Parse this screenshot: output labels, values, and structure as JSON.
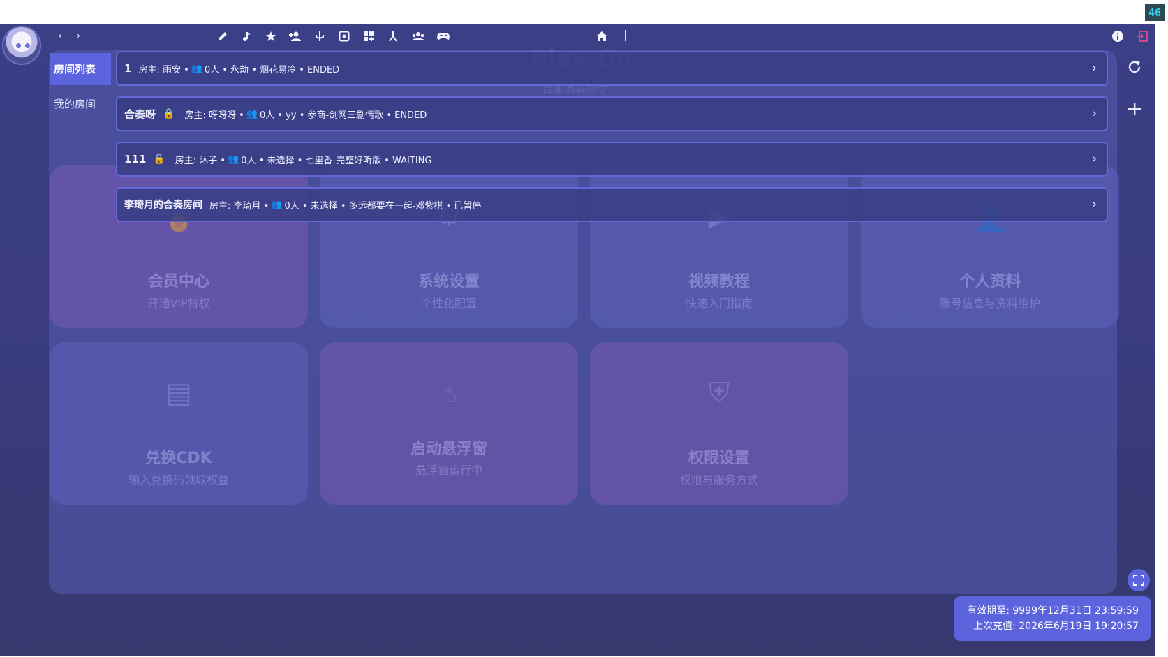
{
  "status": {
    "fps": "46"
  },
  "header": {
    "nav_back": "‹",
    "nav_forward": "›",
    "toolbar_icons": [
      "pencil-icon",
      "music-note-icon",
      "star-icon",
      "add-person-icon",
      "usb-icon",
      "gamepad-square-icon",
      "grid-plus-icon",
      "fork-icon",
      "group-icon",
      "controller-icon"
    ],
    "separator": "|",
    "home_icon": "home-icon",
    "info_icon": "info-icon",
    "exit_icon": "exit-icon"
  },
  "tabs": {
    "room_list": "房间列表",
    "my_rooms": "我的房间"
  },
  "rooms": [
    {
      "name": "1",
      "owner_label": "房主: 雨安 •",
      "count": "0人 • 永劫 • 烟花易冷 • ENDED",
      "locked": false
    },
    {
      "name": "合奏呀",
      "owner_label": "房主: 呀呀呀 •",
      "count": "0人 • yy • 参商-剑网三剧情歌 • ENDED",
      "locked": true
    },
    {
      "name": "111",
      "owner_label": "房主: 沐子 •",
      "count": "0人 • 未选择 • 七里香-完整好听版 • WAITING",
      "locked": true
    },
    {
      "name": "李琦月的合奏房间",
      "owner_label": "房主: 李琦月 •",
      "count": "0人 • 未选择 • 多远都要在一起-邓紫棋 • 已暂停",
      "locked": false
    }
  ],
  "background_cards": [
    {
      "title": "会员中心",
      "subtitle": "开通VIP特权",
      "icon": "medal-icon"
    },
    {
      "title": "系统设置",
      "subtitle": "个性化配置",
      "icon": "gear-icon"
    },
    {
      "title": "视频教程",
      "subtitle": "快速入门指南",
      "icon": "play-icon"
    },
    {
      "title": "个人资料",
      "subtitle": "账号信息与资料维护",
      "icon": "person-icon"
    },
    {
      "title": "兑换CDK",
      "subtitle": "输入兑换码领取权益",
      "icon": "card-icon"
    },
    {
      "title": "启动悬浮窗",
      "subtitle": "悬浮窗运行中",
      "icon": "pointer-icon"
    },
    {
      "title": "权限设置",
      "subtitle": "权限与服务方式",
      "icon": "shield-icon"
    }
  ],
  "background_brand": {
    "title": "Play-Go",
    "subtitle": "智能演奏助手"
  },
  "expiry": {
    "valid_until": "有效期至: 9999年12月31日 23:59:59",
    "last_recharge": "上次充值: 2026年6月19日 19:20:57"
  },
  "colors": {
    "accent": "#5b63dd",
    "background": "#3b3f86",
    "room_border": "#6268d8",
    "people_icon": "#3d8cff"
  }
}
